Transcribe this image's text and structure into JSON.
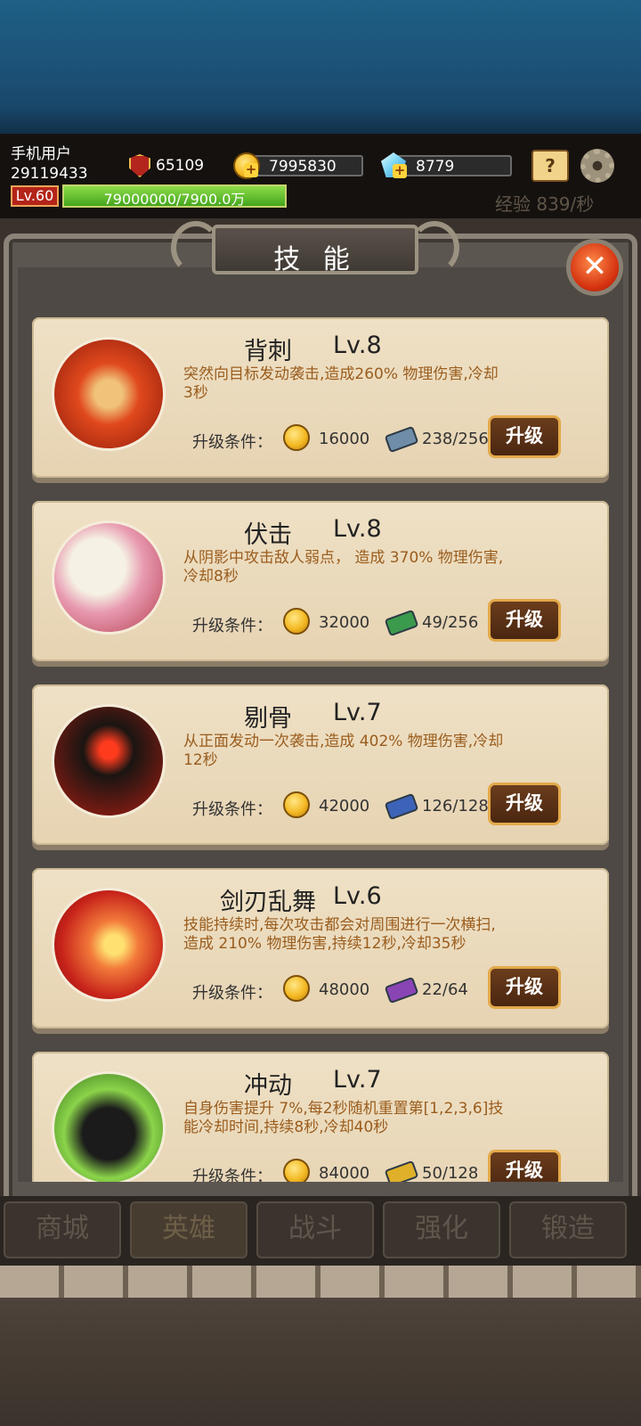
{
  "header": {
    "username": "手机用户",
    "user_id": "29119433",
    "power": "65109",
    "gold": "7995830",
    "gems": "8779",
    "level": "Lv.60",
    "exp_text": "79000000/7900.0万",
    "exp_fraction": 1.0,
    "exp_rate": "经验 839/秒",
    "icons": {
      "power": "sword-shield-icon",
      "gold": "gold-coin-icon",
      "gems": "diamond-icon",
      "guide": "question-book-icon",
      "settings": "gear-icon"
    }
  },
  "panel": {
    "title": "技 能",
    "close_icon": "close-icon"
  },
  "skills": [
    {
      "name": "背刺",
      "level": "Lv.8",
      "desc": "突然向目标发动袭击,造成260% 物理伤害,冷却3秒",
      "cond_label": "升级条件：",
      "cost": "16000",
      "scroll": "238/256",
      "scroll_color": "#6f8da8",
      "upgrade": "升级"
    },
    {
      "name": "伏击",
      "level": "Lv.8",
      "desc": "从阴影中攻击敌人弱点， 造成 370% 物理伤害,冷却8秒",
      "cond_label": "升级条件：",
      "cost": "32000",
      "scroll": "49/256",
      "scroll_color": "#3b9a4c",
      "upgrade": "升级"
    },
    {
      "name": "剔骨",
      "level": "Lv.7",
      "desc": "从正面发动一次袭击,造成 402% 物理伤害,冷却12秒",
      "cond_label": "升级条件：",
      "cost": "42000",
      "scroll": "126/128",
      "scroll_color": "#3d63b8",
      "upgrade": "升级"
    },
    {
      "name": "剑刃乱舞",
      "level": "Lv.6",
      "desc": "技能持续时,每次攻击都会对周围进行一次横扫,造成 210% 物理伤害,持续12秒,冷却35秒",
      "cond_label": "升级条件：",
      "cost": "48000",
      "scroll": "22/64",
      "scroll_color": "#8a45b5",
      "upgrade": "升级"
    },
    {
      "name": "冲动",
      "level": "Lv.7",
      "desc": "自身伤害提升 7%,每2秒随机重置第[1,2,3,6]技能冷却时间,持续8秒,冷却40秒",
      "cond_label": "升级条件：",
      "cost": "84000",
      "scroll": "50/128",
      "scroll_color": "#e0b02a",
      "upgrade": "升级"
    }
  ],
  "nav": {
    "tabs": [
      "商城",
      "英雄",
      "战斗",
      "强化",
      "锻造"
    ],
    "active": "英雄"
  }
}
